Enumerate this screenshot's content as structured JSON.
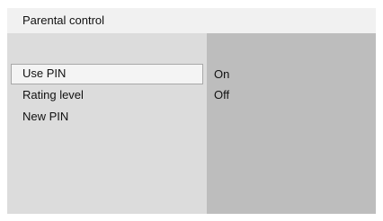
{
  "header": {
    "title": "Parental control"
  },
  "menu": {
    "items": [
      {
        "label": "Use PIN",
        "selected": true
      },
      {
        "label": "Rating level",
        "selected": false
      },
      {
        "label": "New PIN",
        "selected": false
      }
    ]
  },
  "options": {
    "items": [
      {
        "label": "On"
      },
      {
        "label": "Off"
      }
    ]
  },
  "colors": {
    "title_bar": "#f1f1f1",
    "menu_pane": "#dcdcdc",
    "options_pane": "#bdbdbd",
    "selection_fill": "#f4f4f4",
    "selection_border": "#a8a8a8"
  }
}
